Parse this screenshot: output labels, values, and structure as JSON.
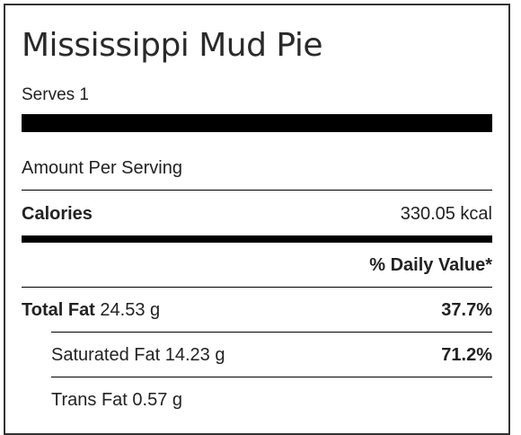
{
  "title": "Mississippi Mud Pie",
  "serves": "Serves 1",
  "amount_per_serving": "Amount Per Serving",
  "calories": {
    "label": "Calories",
    "value": "330.05 kcal"
  },
  "daily_value_header": "% Daily Value*",
  "nutrients": [
    {
      "label": "Total Fat",
      "amount": "24.53 g",
      "dv": "37.7%"
    },
    {
      "label": "Saturated Fat",
      "amount": "14.23 g",
      "dv": "71.2%"
    },
    {
      "label": "Trans Fat",
      "amount": "0.57 g",
      "dv": ""
    }
  ]
}
